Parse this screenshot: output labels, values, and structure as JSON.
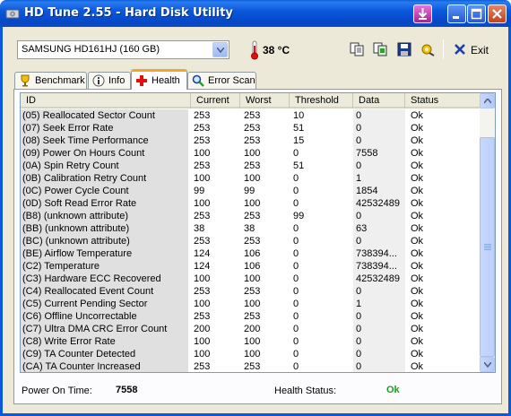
{
  "window": {
    "title": "HD Tune 2.55 - Hard Disk Utility"
  },
  "toolbar": {
    "drive": "SAMSUNG HD161HJ (160 GB)",
    "temperature": "38 °C",
    "exit_label": "Exit",
    "icons": [
      "copy-icon",
      "copy-info-icon",
      "save-icon",
      "options-icon"
    ]
  },
  "tabs": [
    {
      "label": "Benchmark",
      "icon": "benchmark-icon"
    },
    {
      "label": "Info",
      "icon": "info-icon"
    },
    {
      "label": "Health",
      "icon": "health-cross-icon",
      "active": true
    },
    {
      "label": "Error Scan",
      "icon": "magnifier-icon"
    }
  ],
  "table": {
    "columns": [
      "ID",
      "Current",
      "Worst",
      "Threshold",
      "Data",
      "Status"
    ],
    "rows": [
      [
        "(05) Reallocated Sector Count",
        "253",
        "253",
        "10",
        "0",
        "Ok"
      ],
      [
        "(07) Seek Error Rate",
        "253",
        "253",
        "51",
        "0",
        "Ok"
      ],
      [
        "(08) Seek Time Performance",
        "253",
        "253",
        "15",
        "0",
        "Ok"
      ],
      [
        "(09) Power On Hours Count",
        "100",
        "100",
        "0",
        "7558",
        "Ok"
      ],
      [
        "(0A) Spin Retry Count",
        "253",
        "253",
        "51",
        "0",
        "Ok"
      ],
      [
        "(0B) Calibration Retry Count",
        "100",
        "100",
        "0",
        "1",
        "Ok"
      ],
      [
        "(0C) Power Cycle Count",
        "99",
        "99",
        "0",
        "1854",
        "Ok"
      ],
      [
        "(0D) Soft Read Error Rate",
        "100",
        "100",
        "0",
        "42532489",
        "Ok"
      ],
      [
        "(B8) (unknown attribute)",
        "253",
        "253",
        "99",
        "0",
        "Ok"
      ],
      [
        "(BB) (unknown attribute)",
        "38",
        "38",
        "0",
        "63",
        "Ok"
      ],
      [
        "(BC) (unknown attribute)",
        "253",
        "253",
        "0",
        "0",
        "Ok"
      ],
      [
        "(BE) Airflow Temperature",
        "124",
        "106",
        "0",
        "738394...",
        "Ok"
      ],
      [
        "(C2) Temperature",
        "124",
        "106",
        "0",
        "738394...",
        "Ok"
      ],
      [
        "(C3) Hardware ECC Recovered",
        "100",
        "100",
        "0",
        "42532489",
        "Ok"
      ],
      [
        "(C4) Reallocated Event Count",
        "253",
        "253",
        "0",
        "0",
        "Ok"
      ],
      [
        "(C5) Current Pending Sector",
        "100",
        "100",
        "0",
        "1",
        "Ok"
      ],
      [
        "(C6) Offline Uncorrectable",
        "253",
        "253",
        "0",
        "0",
        "Ok"
      ],
      [
        "(C7) Ultra DMA CRC Error Count",
        "200",
        "200",
        "0",
        "0",
        "Ok"
      ],
      [
        "(C8) Write Error Rate",
        "100",
        "100",
        "0",
        "0",
        "Ok"
      ],
      [
        "(C9) TA Counter Detected",
        "100",
        "100",
        "0",
        "0",
        "Ok"
      ],
      [
        "(CA) TA Counter Increased",
        "253",
        "253",
        "0",
        "0",
        "Ok"
      ]
    ]
  },
  "footer": {
    "power_on_label": "Power On Time:",
    "power_on_value": "7558",
    "health_label": "Health Status:",
    "health_value": "Ok"
  },
  "colors": {
    "title_bar": "#0b58dc",
    "health_ok": "#1aa01a",
    "active_tab_accent": "#f3a728"
  }
}
